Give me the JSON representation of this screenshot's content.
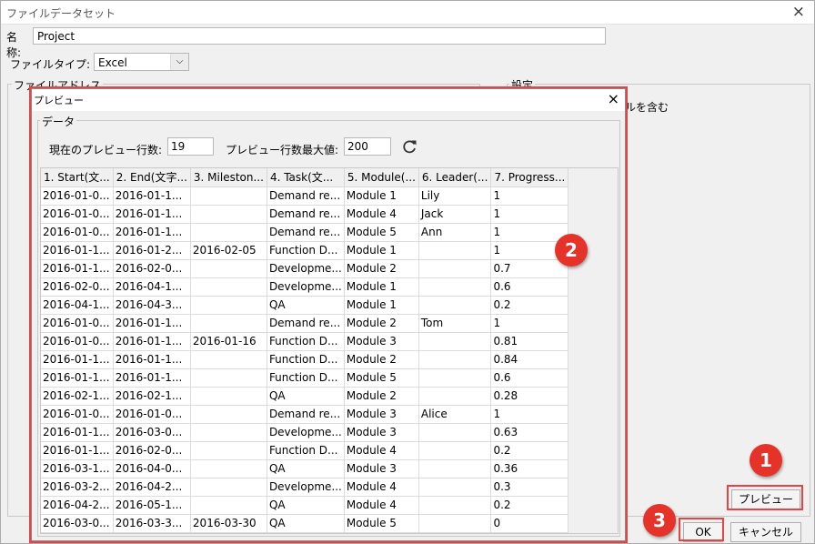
{
  "window": {
    "title": "ファイルデータセット",
    "close_icon": "×"
  },
  "name_field": {
    "label": "名称:",
    "value": "Project"
  },
  "filetype": {
    "label": "ファイルタイプ:",
    "value": "Excel",
    "arrow": "⌵"
  },
  "file_address_group": {
    "legend": "ファイルアドレス"
  },
  "settings_group": {
    "legend": "設定",
    "include_label": "ルを含む"
  },
  "buttons": {
    "preview": "プレビュー",
    "ok": "OK",
    "cancel": "キャンセル"
  },
  "badges": {
    "one": "1",
    "two": "2",
    "three": "3"
  },
  "accent_color": "#e5332a",
  "preview_dialog": {
    "title": "プレビュー",
    "close_icon": "×",
    "data_legend": "データ",
    "current_rows_label": "現在のプレビュー行数:",
    "current_rows_value": "19",
    "max_rows_label": "プレビュー行数最大値:",
    "max_rows_value": "200",
    "refresh_icon": "refresh-icon",
    "columns": [
      "1. Start(文...",
      "2. End(文字...",
      "3. Mileston...",
      "4. Task(文...",
      "5. Module(...",
      "6. Leader(...",
      "7. Progress..."
    ],
    "rows": [
      [
        "2016-01-0...",
        "2016-01-1...",
        "",
        "Demand re...",
        "Module 1",
        "Lily",
        "1"
      ],
      [
        "2016-01-0...",
        "2016-01-1...",
        "",
        "Demand re...",
        "Module 4",
        "Jack",
        "1"
      ],
      [
        "2016-01-0...",
        "2016-01-1...",
        "",
        "Demand re...",
        "Module 5",
        "Ann",
        "1"
      ],
      [
        "2016-01-1...",
        "2016-01-2...",
        "2016-02-05",
        "Function D...",
        "Module 1",
        "",
        "1"
      ],
      [
        "2016-01-1...",
        "2016-02-0...",
        "",
        "Developme...",
        "Module 2",
        "",
        "0.7"
      ],
      [
        "2016-02-0...",
        "2016-04-1...",
        "",
        "Developme...",
        "Module 1",
        "",
        "0.6"
      ],
      [
        "2016-04-1...",
        "2016-04-3...",
        "",
        "QA",
        "Module 1",
        "",
        "0.2"
      ],
      [
        "2016-01-0...",
        "2016-01-1...",
        "",
        "Demand re...",
        "Module 2",
        "Tom",
        "1"
      ],
      [
        "2016-01-0...",
        "2016-01-1...",
        "2016-01-16",
        "Function D...",
        "Module 3",
        "",
        "0.81"
      ],
      [
        "2016-01-1...",
        "2016-01-1...",
        "",
        "Function D...",
        "Module 2",
        "",
        "0.84"
      ],
      [
        "2016-01-1...",
        "2016-01-1...",
        "",
        "Function D...",
        "Module 5",
        "",
        "0.6"
      ],
      [
        "2016-02-1...",
        "2016-02-1...",
        "",
        "QA",
        "Module 2",
        "",
        "0.28"
      ],
      [
        "2016-01-0...",
        "2016-01-0...",
        "",
        "Demand re...",
        "Module 3",
        "Alice",
        "1"
      ],
      [
        "2016-01-1...",
        "2016-03-0...",
        "",
        "Developme...",
        "Module 3",
        "",
        "0.63"
      ],
      [
        "2016-01-1...",
        "2016-02-0...",
        "",
        "Function D...",
        "Module 4",
        "",
        "0.2"
      ],
      [
        "2016-03-1...",
        "2016-04-0...",
        "",
        "QA",
        "Module 3",
        "",
        "0.36"
      ],
      [
        "2016-03-2...",
        "2016-04-2...",
        "",
        "Developme...",
        "Module 4",
        "",
        "0.3"
      ],
      [
        "2016-04-2...",
        "2016-05-1...",
        "",
        "QA",
        "Module 4",
        "",
        "0.2"
      ],
      [
        "2016-03-0...",
        "2016-03-3...",
        "2016-03-30",
        "QA",
        "Module 5",
        "",
        "0"
      ]
    ]
  }
}
